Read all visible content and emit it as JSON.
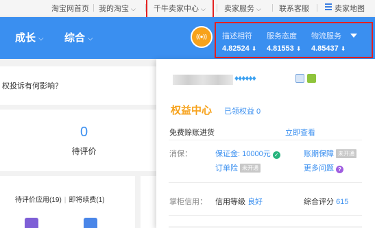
{
  "topbar": {
    "links": [
      "淘宝网首页",
      "我的淘宝",
      "千牛卖家中心",
      "卖家服务",
      "联系客服",
      "卖家地图"
    ]
  },
  "nav": {
    "items": [
      "成长",
      "综合"
    ],
    "badge_text": "((●))",
    "scores": [
      {
        "label": "描述相符",
        "value": "4.82524",
        "trend": "⬇"
      },
      {
        "label": "服务态度",
        "value": "4.81553",
        "trend": "⬇"
      },
      {
        "label": "物流服务",
        "value": "4.85437",
        "trend": "⬇"
      }
    ]
  },
  "left": {
    "question": "权投诉有何影响？",
    "pending_count": "0",
    "pending_label": "待评价",
    "app_link": "待评价应用(19)",
    "renew_link": "即将续费(1)"
  },
  "card": {
    "diamonds": "♦♦♦♦♦♦",
    "rights_title": "权益中心",
    "rights_sub": "已领权益 0",
    "free_loan": "免费赊账进货",
    "view_now": "立即查看",
    "consumer_label": "消保：",
    "deposit": "保证金: 10000元",
    "account_guarantee": "账期保障",
    "not_open_1": "未开通",
    "order_insurance": "订单险",
    "not_open_2": "未开通",
    "more_questions": "更多问题",
    "credit_label": "掌柜信用：",
    "credit_level": "信用等级",
    "credit_value": "良好",
    "overall_label": "综合评分",
    "overall_value": "615"
  },
  "colors": {
    "brand_blue": "#3a8ff0",
    "accent_orange": "#f7a21b",
    "highlight_red": "#e42121"
  }
}
